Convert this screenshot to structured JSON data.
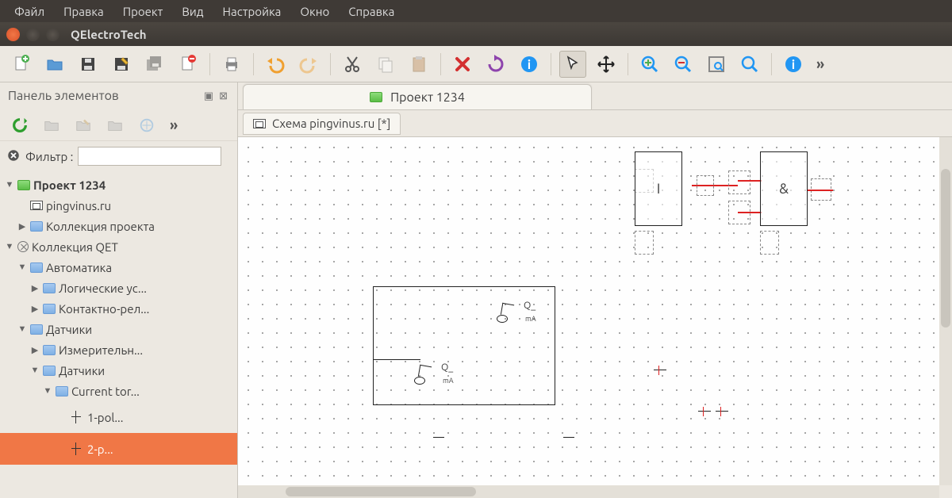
{
  "menubar": [
    "Файл",
    "Правка",
    "Проект",
    "Вид",
    "Настройка",
    "Окно",
    "Справка"
  ],
  "app_title": "QElectroTech",
  "panel": {
    "title": "Панель элементов",
    "filter_label": "Фильтр :",
    "filter_value": ""
  },
  "tree": {
    "project": "Проект 1234",
    "diagram": "pingvinus.ru",
    "proj_collection": "Коллекция проекта",
    "qet_collection": "Коллекция QET",
    "automation": "Автоматика",
    "logic": "Логические ус...",
    "contact": "Контактно-рел...",
    "sensors": "Датчики",
    "measuring": "Измерительн...",
    "sensors2": "Датчики",
    "current_tor": "Current tor...",
    "item_1pol": "1-pol...",
    "item_2p": "2-p..."
  },
  "tabs": {
    "project": "Проект 1234",
    "document": "Схема pingvinus.ru [*]"
  },
  "schematic": {
    "q_label": "Q_",
    "ma_label": "mA",
    "logic_i": "I",
    "logic_and": "&"
  }
}
